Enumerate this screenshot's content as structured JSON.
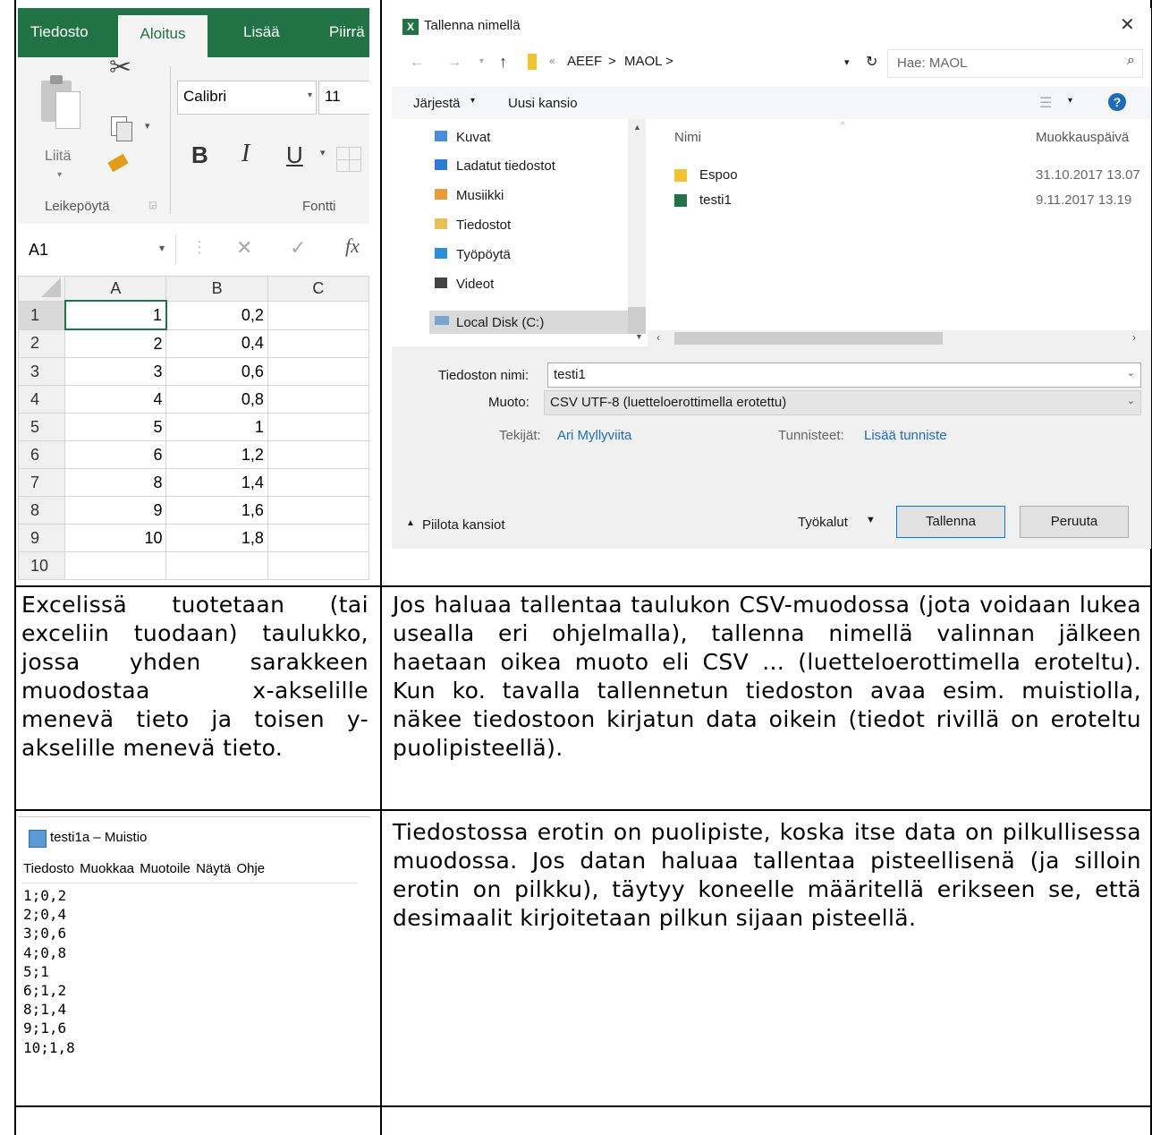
{
  "excel": {
    "tabs": [
      "Tiedosto",
      "Aloitus",
      "Lisää",
      "Piirrä"
    ],
    "paste_label": "Liitä",
    "clipboard_group": "Leikepöytä",
    "font_name": "Calibri",
    "font_size": "11",
    "font_group": "Fontti",
    "bold": "B",
    "italic": "I",
    "underline": "U",
    "name_box": "A1",
    "fx": "fx",
    "column_headers": [
      "A",
      "B",
      "C"
    ],
    "rows": [
      {
        "row": "1",
        "a": "1",
        "b": "0,2"
      },
      {
        "row": "2",
        "a": "2",
        "b": "0,4"
      },
      {
        "row": "3",
        "a": "3",
        "b": "0,6"
      },
      {
        "row": "4",
        "a": "4",
        "b": "0,8"
      },
      {
        "row": "5",
        "a": "5",
        "b": "1"
      },
      {
        "row": "6",
        "a": "6",
        "b": "1,2"
      },
      {
        "row": "7",
        "a": "8",
        "b": "1,4"
      },
      {
        "row": "8",
        "a": "9",
        "b": "1,6"
      },
      {
        "row": "9",
        "a": "10",
        "b": "1,8"
      },
      {
        "row": "10",
        "a": "",
        "b": ""
      }
    ]
  },
  "dialog": {
    "title": "Tallenna nimellä",
    "close": "✕",
    "breadcrumb": [
      "AEEF",
      "MAOL"
    ],
    "search_placeholder": "Hae: MAOL",
    "organize": "Järjestä",
    "new_folder": "Uusi kansio",
    "nav_items": [
      "Kuvat",
      "Ladatut tiedostot",
      "Musiikki",
      "Tiedostot",
      "Työpöytä",
      "Videot",
      "Local Disk (C:)"
    ],
    "col_name": "Nimi",
    "col_modified": "Muokkauspäivä",
    "files": [
      {
        "name": "Espoo",
        "date": "31.10.2017 13.07"
      },
      {
        "name": "testi1",
        "date": "9.11.2017 13.19"
      }
    ],
    "filename_label": "Tiedoston nimi:",
    "filename_value": "testi1",
    "format_label": "Muoto:",
    "format_value": "CSV UTF-8 (luetteloerottimella erotettu)",
    "authors_label": "Tekijät:",
    "authors_value": "Ari Myllyviita",
    "tags_label": "Tunnisteet:",
    "tags_value": "Lisää tunniste",
    "hide_folders": "Piilota kansiot",
    "tools": "Työkalut",
    "save": "Tallenna",
    "cancel": "Peruuta"
  },
  "text": {
    "left1": "Excelissä tuotetaan (tai exceliin tuodaan) taulukko, jossa yhden sarakkeen muodostaa x-akselille menevä tieto ja toisen y-akselille menevä tieto.",
    "right1": "Jos haluaa tallentaa taulukon CSV-muodossa (jota voidaan lukea usealla eri ohjelmalla), tallenna nimellä valinnan jälkeen haetaan oikea muoto eli CSV … (luetteloerottimella eroteltu). Kun ko. tavalla tallennetun tiedoston avaa esim. muistiolla, näkee tiedostoon kirjatun data oikein (tiedot rivillä on eroteltu puolipisteellä).",
    "right2": "Tiedostossa erotin on puolipiste, koska itse data on pilkullisessa muodossa. Jos datan haluaa tallentaa pisteellisenä (ja silloin erotin on pilkku), täytyy koneelle määritellä erikseen se, että desimaalit kirjoitetaan pilkun sijaan pisteellä."
  },
  "notepad": {
    "title": "testi1a – Muistio",
    "menu": [
      "Tiedosto",
      "Muokkaa",
      "Muotoile",
      "Näytä",
      "Ohje"
    ],
    "content": "1;0,2\n2;0,4\n3;0,6\n4;0,8\n5;1\n6;1,2\n8;1,4\n9;1,6\n10;1,8"
  }
}
